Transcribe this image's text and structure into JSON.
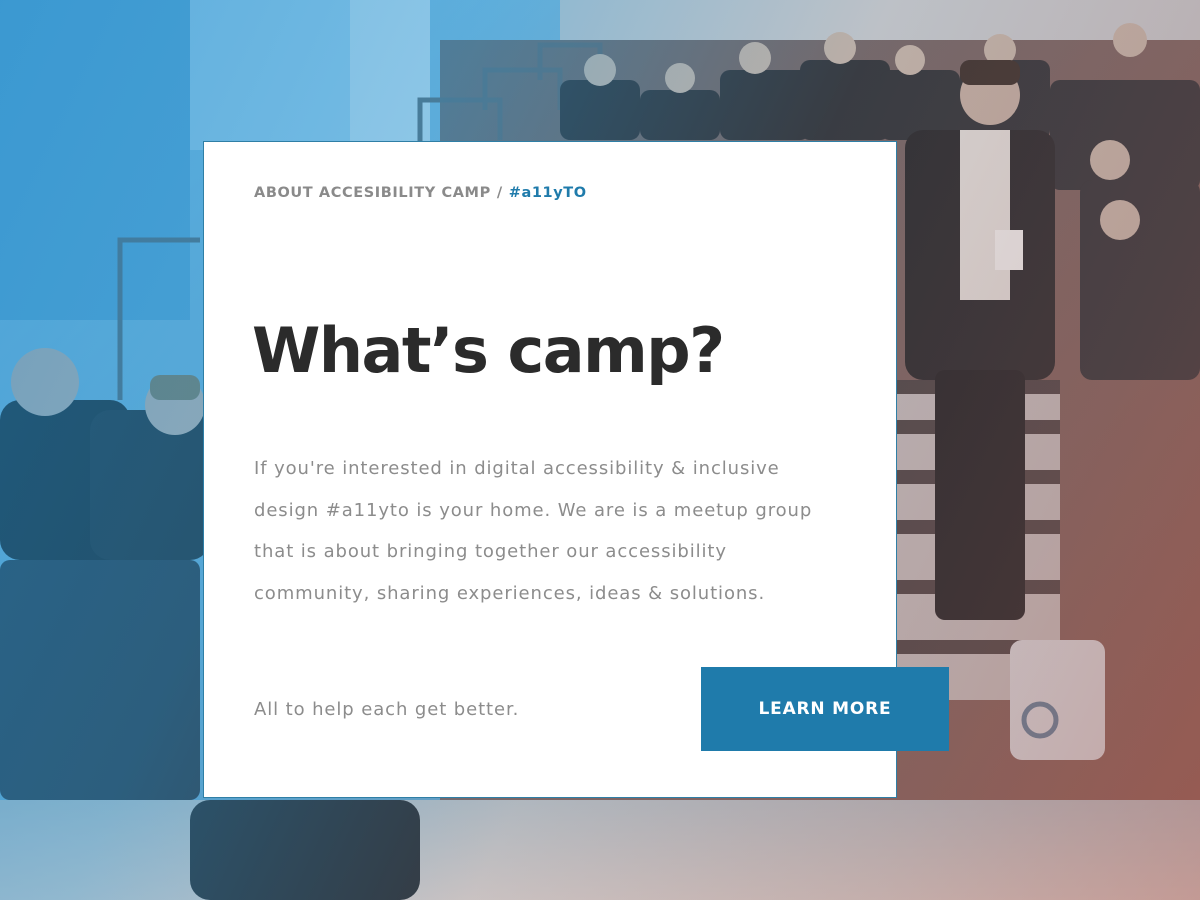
{
  "card": {
    "eyebrow": "ABOUT ACCESIBILITY CAMP",
    "separator": "/",
    "hashtag": "#a11yTO",
    "title": "What’s camp?",
    "body": "If you're interested in digital accessibility & inclusive design #a11yto is your home. We are is a meetup group that is about bringing together our accessibility community, sharing experiences, ideas & solutions.",
    "tagline": "All to help each get better."
  },
  "cta": {
    "label": "LEARN MORE"
  },
  "colors": {
    "accent": "#1f7bab",
    "title": "#2b2b2b",
    "body": "#8c8c8c",
    "eyebrow": "#8a8a8a"
  },
  "background": {
    "image": "audience-photo"
  }
}
